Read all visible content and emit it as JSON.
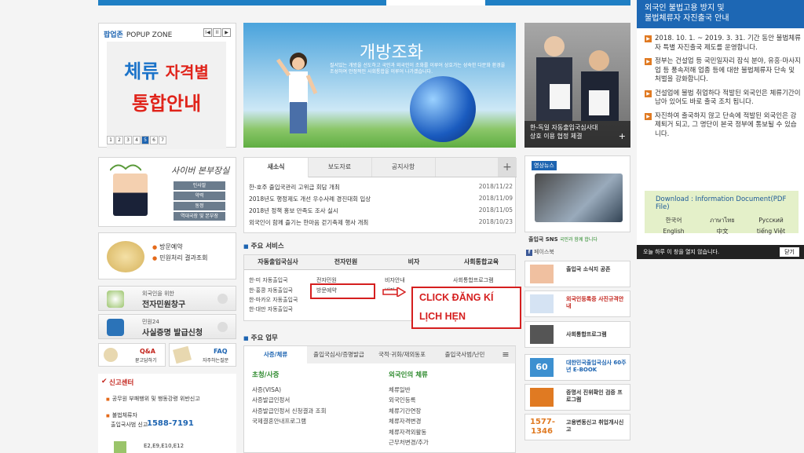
{
  "popup": {
    "label_en": "팝업존",
    "label": "POPUP ZONE",
    "controls": [
      "I◀",
      "II",
      "▶"
    ],
    "image_line1_blue": "체류",
    "image_line1_red": "자격별",
    "image_line2": "통합안내",
    "pages": [
      "1",
      "2",
      "3",
      "4",
      "5",
      "6",
      "7"
    ],
    "active_page": "5"
  },
  "banner": {
    "title": "개방조화",
    "subtitle": "질서있는 개방을 선도하고 국민과 외국인이 조화를 이루어 상호가는 성숙한 다문화 환경을 조성하여 안정적인 사회통합을 이루어 나가겠습니다."
  },
  "photo": {
    "caption_line1": "한-독일 자동출입국심사대",
    "caption_line2": "상호 이용 협정 체결",
    "plus": "+"
  },
  "right_panel": {
    "title_line1": "외국인 불법고용 방지 및",
    "title_line2": "불법체류자 자진출국 안내",
    "items": [
      "2018. 10. 1. ~ 2019. 3. 31. 기간 동안 불법체류자 특별 자진출국 제도를 운영합니다.",
      "정부는 건설업 등 국민일자리 잠식 분야, 유흥·마사지업 등 풍속저해 업종 등에 대한 불법체류자 단속 및 처벌을 강화합니다.",
      "건설업에 불법 취업하다 적발된 외국인은 체류기간이 남아 있어도 바로 출국 조치 됩니다.",
      "자진하여 출국하지 않고 단속에 적발된 외국인은 강제퇴거 되고, 그 명단이 본국 정부에 통보될 수 있습니다."
    ],
    "download_title": "Download : Information Document(PDF File)",
    "languages": [
      [
        "한국어",
        "ภาษาไทย",
        "Русский"
      ],
      [
        "English",
        "中文",
        "tiếng Việt"
      ]
    ],
    "close_text": "오늘 하루 이 창을 열지 않습니다.",
    "close_button": "닫기"
  },
  "minister": {
    "title": "사이버 본부장실",
    "buttons": [
      "인사말",
      "약력",
      "동정",
      "역대국장 및 본부장"
    ]
  },
  "visit": {
    "links": [
      "방문예약",
      "민원처리 결과조회"
    ]
  },
  "side_buttons": [
    {
      "sub": "외국인을 위한",
      "main": "전자민원창구"
    },
    {
      "sub": "민원24",
      "main": "사실증명 발급신청"
    }
  ],
  "qa": {
    "title": "Q&A",
    "sub": "묻고답하기"
  },
  "faq": {
    "title": "FAQ",
    "sub": "자주하는질문"
  },
  "report": {
    "title": "신고센터",
    "links": [
      "공무원 부패행위 및 행동강령 위반신고",
      "불법체류자"
    ],
    "phone_label": "출입국사범 신고",
    "phone": "1588-7191",
    "visa": "E2,E9,E10,E12"
  },
  "news": {
    "tabs": [
      "새소식",
      "보도자료",
      "공지사항"
    ],
    "plus": "+",
    "rows": [
      {
        "title": "한-호주 출입국관리 고위급 회담 개최",
        "date": "2018/11/22"
      },
      {
        "title": "2018년도 행정제도 개선 우수사례 경진대회 입상",
        "date": "2018/11/09"
      },
      {
        "title": "2018년 정책 홍보 만족도 조사 실시",
        "date": "2018/11/05"
      },
      {
        "title": "외국인이 함께 즐기는 한마음 걷기축제 행사 개최",
        "date": "2018/10/23"
      }
    ]
  },
  "services": {
    "heading": "주요 서비스",
    "columns": [
      "자동출입국심사",
      "전자민원",
      "비자",
      "사회통합교육"
    ],
    "col1": [
      "한·미 자동출입국",
      "한·홍콩 자동출입국",
      "한·마카오 자동출입국",
      "한·대만 자동출입국"
    ],
    "col2": [
      "전자민원",
      "방문예약"
    ],
    "col3": [
      "비자안내",
      "비자"
    ],
    "col4": [
      "사회통합프로그램"
    ]
  },
  "annotation": {
    "line1": "CLICK ĐĂNG KÍ",
    "line2": "LỊCH HẸN"
  },
  "work": {
    "heading": "주요 업무",
    "tabs": [
      "사증/체류",
      "출입국심사/증명발급",
      "국적·귀화/재외동포",
      "출입국사범/난민"
    ],
    "col1_title": "초청/사증",
    "col1": [
      "사증(VISA)",
      "사증발급인정서",
      "사증발급인정서 신청결과 조회",
      "국제결혼안내프로그램"
    ],
    "col2_title": "외국인의 체류",
    "col2": [
      "체류일반",
      "외국인등록",
      "체류기간연장",
      "체류자격변경",
      "체류자격외활동",
      "근무처변경/추가"
    ]
  },
  "video": {
    "label": "영상뉴스"
  },
  "sns": {
    "label": "출입국 SNS",
    "tagline": "국민과 함께 합니다",
    "fb": "페이스북"
  },
  "right_buttons": [
    "출입국 소식지 공존",
    "외국인등록증 사진규격안내",
    "사회통합프로그램",
    "대한민국출입국심사 60주년 E-BOOK",
    "증명서 진위확인 검증 프로그램",
    "고용변동신고 취업개시신고"
  ],
  "colors": {
    "accent": "#1d64b1",
    "highlight": "#d51f1f",
    "orange": "#e07a22"
  }
}
